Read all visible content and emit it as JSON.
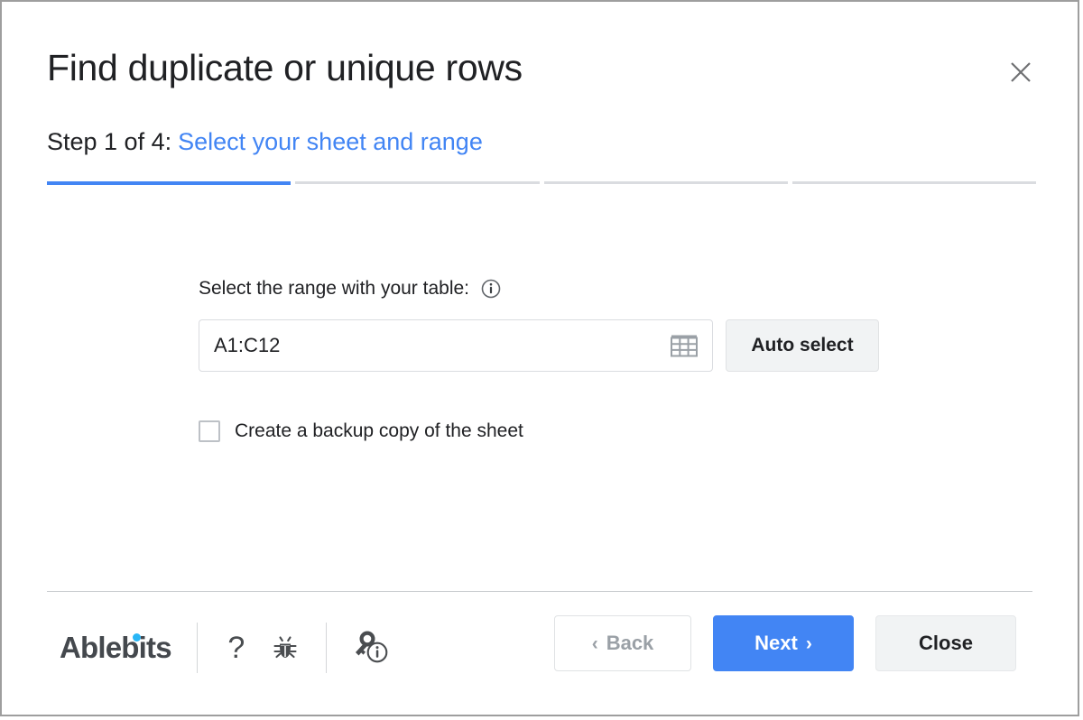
{
  "dialog": {
    "title": "Find duplicate or unique rows",
    "close_label": "×",
    "close_icon": "close-icon"
  },
  "step": {
    "prefix": "Step 1 of 4:",
    "name": "Select your sheet and range",
    "current": 1,
    "total": 4,
    "accent_color": "#4285f4",
    "inactive_color": "#dadce0"
  },
  "form": {
    "range_label": "Select the range with your table:",
    "info_icon": "info-icon",
    "range_value": "A1:C12",
    "range_placeholder": "A1:C12",
    "range_picker_icon": "grid-select-icon",
    "auto_select_label": "Auto select",
    "backup_label": "Create a backup copy of the sheet",
    "backup_checked": false
  },
  "footer": {
    "brand": "Ablebits",
    "brand_color": "#44484d",
    "brand_dot_color": "#29b6f6",
    "help_icon": "question-mark-icon",
    "help_label": "?",
    "bug_icon": "bug-icon",
    "license_icon": "key-info-icon",
    "buttons": {
      "back_label": "Back",
      "back_chevron": "‹",
      "next_label": "Next",
      "next_chevron": "›",
      "close_label": "Close"
    }
  }
}
